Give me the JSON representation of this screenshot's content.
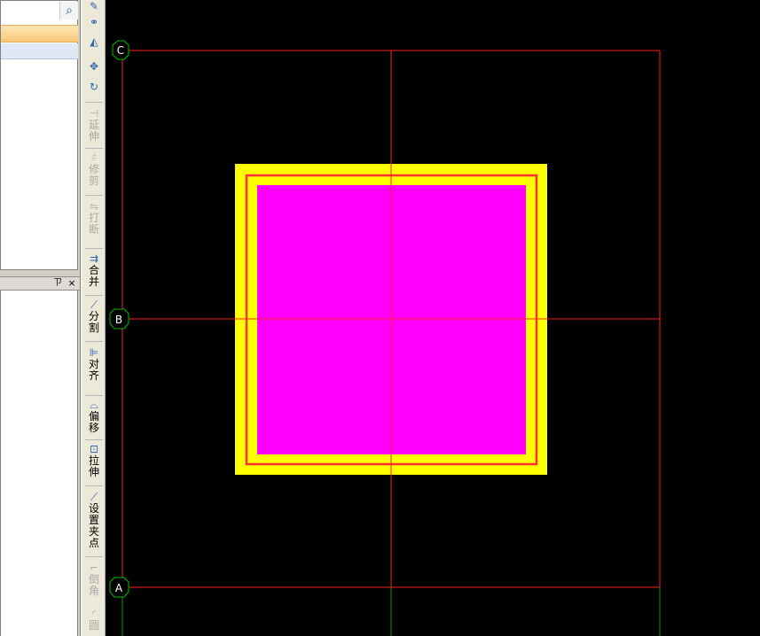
{
  "sidebar": {
    "search_icon": "search-icon",
    "panel2_pin": "ㄗ",
    "panel2_close": "×"
  },
  "toolbar": {
    "items": [
      {
        "label": "延伸",
        "icon": "extend-icon",
        "enabled": false
      },
      {
        "label": "修剪",
        "icon": "trim-icon",
        "enabled": false
      },
      {
        "label": "打断",
        "icon": "break-icon",
        "enabled": false
      },
      {
        "label": "合并",
        "icon": "merge-icon",
        "enabled": true
      },
      {
        "label": "分割",
        "icon": "split-icon",
        "enabled": true
      },
      {
        "label": "对齐",
        "icon": "align-icon",
        "enabled": true
      },
      {
        "label": "偏移",
        "icon": "offset-icon",
        "enabled": true
      },
      {
        "label": "拉伸",
        "icon": "stretch-icon",
        "enabled": true
      },
      {
        "label": "设置夹点",
        "icon": "grip-icon",
        "enabled": true
      },
      {
        "label": "倒角",
        "icon": "chamfer-icon",
        "enabled": false
      },
      {
        "label": "圆",
        "icon": "fillet-icon",
        "enabled": false
      }
    ]
  },
  "canvas": {
    "axes": [
      {
        "label": "C"
      },
      {
        "label": "B"
      },
      {
        "label": "A"
      }
    ],
    "colors": {
      "background": "#000000",
      "grid_line": "#ff2020",
      "grid_line_lower": "#00a000",
      "column_outer": "#ffff00",
      "column_ring": "#ff3030",
      "column_fill": "#ff00ff",
      "axis_bubble": "#00c000"
    }
  }
}
